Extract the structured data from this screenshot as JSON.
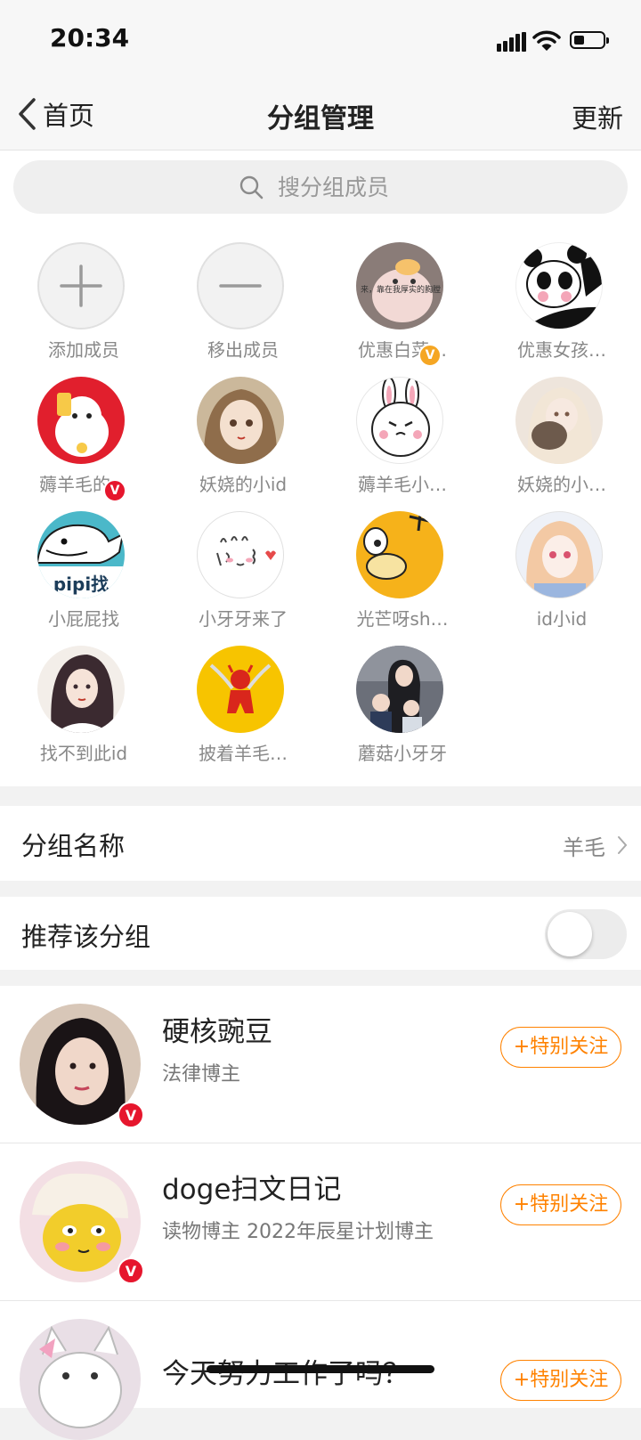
{
  "status": {
    "time": "20:34"
  },
  "nav": {
    "back_label": "首页",
    "title": "分组管理",
    "update_label": "更新"
  },
  "search": {
    "placeholder": "搜分组成员"
  },
  "members": [
    {
      "name": "添加成员"
    },
    {
      "name": "移出成员"
    },
    {
      "name": "优惠白菜…",
      "avatar_text": "来，靠在我厚实的胸膛"
    },
    {
      "name": "优惠女孩…"
    },
    {
      "name": "薅羊毛的…"
    },
    {
      "name": "妖娆的小id"
    },
    {
      "name": "薅羊毛小…"
    },
    {
      "name": "妖娆的小…"
    },
    {
      "name": "小屁屁找",
      "avatar_text": "pipi找"
    },
    {
      "name": "小牙牙来了"
    },
    {
      "name": "光芒呀sh…"
    },
    {
      "name": "id小id"
    },
    {
      "name": "找不到此id"
    },
    {
      "name": "披着羊毛…"
    },
    {
      "name": "蘑菇小牙牙"
    }
  ],
  "settings": {
    "group_name_label": "分组名称",
    "group_name_value": "羊毛",
    "recommend_label": "推荐该分组",
    "recommend_on": false
  },
  "users": [
    {
      "name": "硬核豌豆",
      "desc": "法律博主",
      "follow_label": "+特别关注"
    },
    {
      "name": "doge扫文日记",
      "desc": "读物博主 2022年辰星计划博主",
      "follow_label": "+特别关注"
    },
    {
      "name": "今天努力工作了吗？",
      "desc": "",
      "follow_label": "+特别关注"
    }
  ],
  "colors": {
    "accent": "#ff8200",
    "verified_orange": "#f5a623",
    "verified_red": "#e6162d"
  }
}
